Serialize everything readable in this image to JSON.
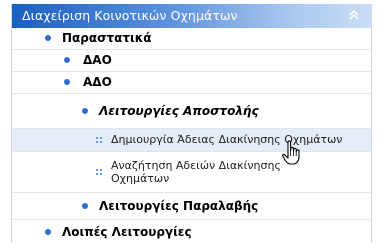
{
  "header": {
    "title": "Διαχείριση Κοινοτικών Οχημάτων"
  },
  "menu": {
    "items": [
      {
        "label": "Παραστατικά"
      },
      {
        "label": "ΔΑΟ"
      },
      {
        "label": "ΑΔΟ"
      },
      {
        "label": "Λειτουργίες Αποστολής"
      },
      {
        "label": "Δημιουργία Άδειας Διακίνησης Οχημάτων"
      },
      {
        "label_line1": "Αναζήτηση Αδειών Διακίνησης",
        "label_line2": "Οχημάτων"
      },
      {
        "label": "Λειτουργίες Παραλαβής"
      },
      {
        "label": "Λοιπές Λειτουργίες"
      }
    ]
  },
  "colors": {
    "header_start": "#1a5fc0",
    "header_end": "#c9dcf6",
    "bullet": "#2f6fcc",
    "hover_row": "#e4ecf7"
  },
  "icons": {
    "collapse": "double-chevron-up-icon",
    "cursor": "hand-pointer-icon"
  }
}
